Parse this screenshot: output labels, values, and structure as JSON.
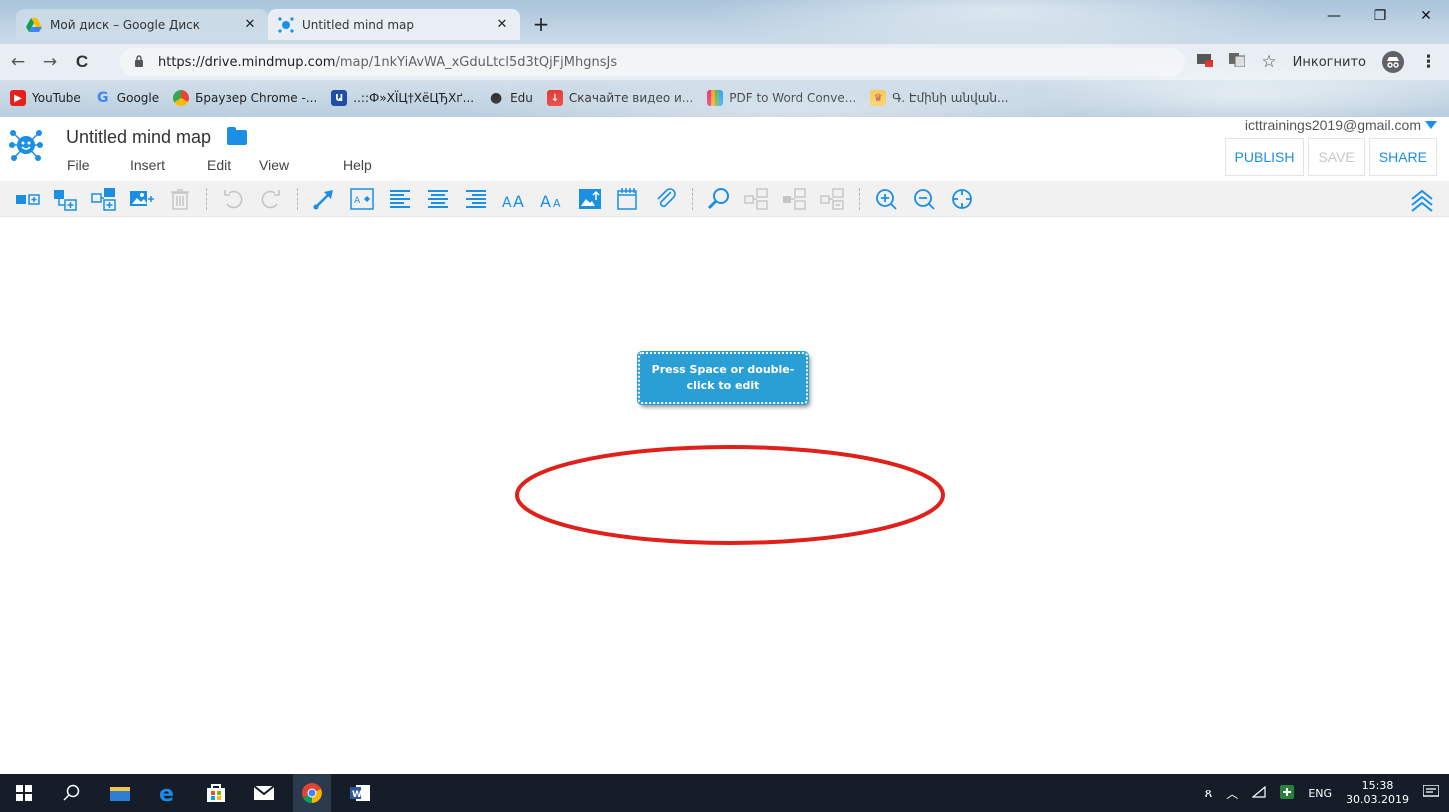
{
  "browser": {
    "tabs": [
      {
        "title": "Мой диск – Google Диск",
        "close": "✕"
      },
      {
        "title": "Untitled mind map",
        "close": "✕"
      }
    ],
    "new_tab": "+",
    "window_controls": {
      "minimize": "—",
      "restore": "❐",
      "close": "✕"
    },
    "nav": {
      "back": "←",
      "forward": "→",
      "reload": "C"
    },
    "url_host": "https://drive.mindmup.com",
    "url_path": "/map/1nkYiAvWA_xGduLtcl5d3tQjFjMhgnsJs",
    "incognito_label": "Инкогнито",
    "star": "☆",
    "menu": "⋮",
    "bookmarks": [
      {
        "label": "YouTube",
        "icon": "youtube-icon",
        "color": "#e62117"
      },
      {
        "label": "Google",
        "icon": "google-icon",
        "color": "#4285f4"
      },
      {
        "label": "Браузер Chrome -...",
        "icon": "chrome-icon",
        "color": "#f4b400"
      },
      {
        "label": "..::Ф»ХЇЦ†ХёЦЂХґ...",
        "icon": "site-icon",
        "color": "#1f4ea3"
      },
      {
        "label": "Edu",
        "icon": "people-icon",
        "color": "#333333"
      },
      {
        "label": "Скачайте видео и...",
        "icon": "download-icon",
        "color": "#e53935"
      },
      {
        "label": "PDF to Word Conve...",
        "icon": "pdf-icon",
        "color": "#ff9800"
      },
      {
        "label": "Գ. Էմինի անվան...",
        "icon": "school-icon",
        "color": "#d2691e"
      }
    ]
  },
  "app": {
    "title": "Untitled mind map",
    "menu": [
      "File",
      "Insert",
      "Edit",
      "View",
      "Help"
    ],
    "account": "icttrainings2019@gmail.com",
    "actions": {
      "publish": "PUBLISH",
      "save": "SAVE",
      "share": "SHARE"
    },
    "accent": "#1a8fe3",
    "node_color": "#2a9fd6",
    "node_text": "Press Space or double-click to edit",
    "annotation_color": "#e0201b"
  },
  "taskbar": {
    "lang": "ENG",
    "time": "15:38",
    "date": "30.03.2019"
  }
}
